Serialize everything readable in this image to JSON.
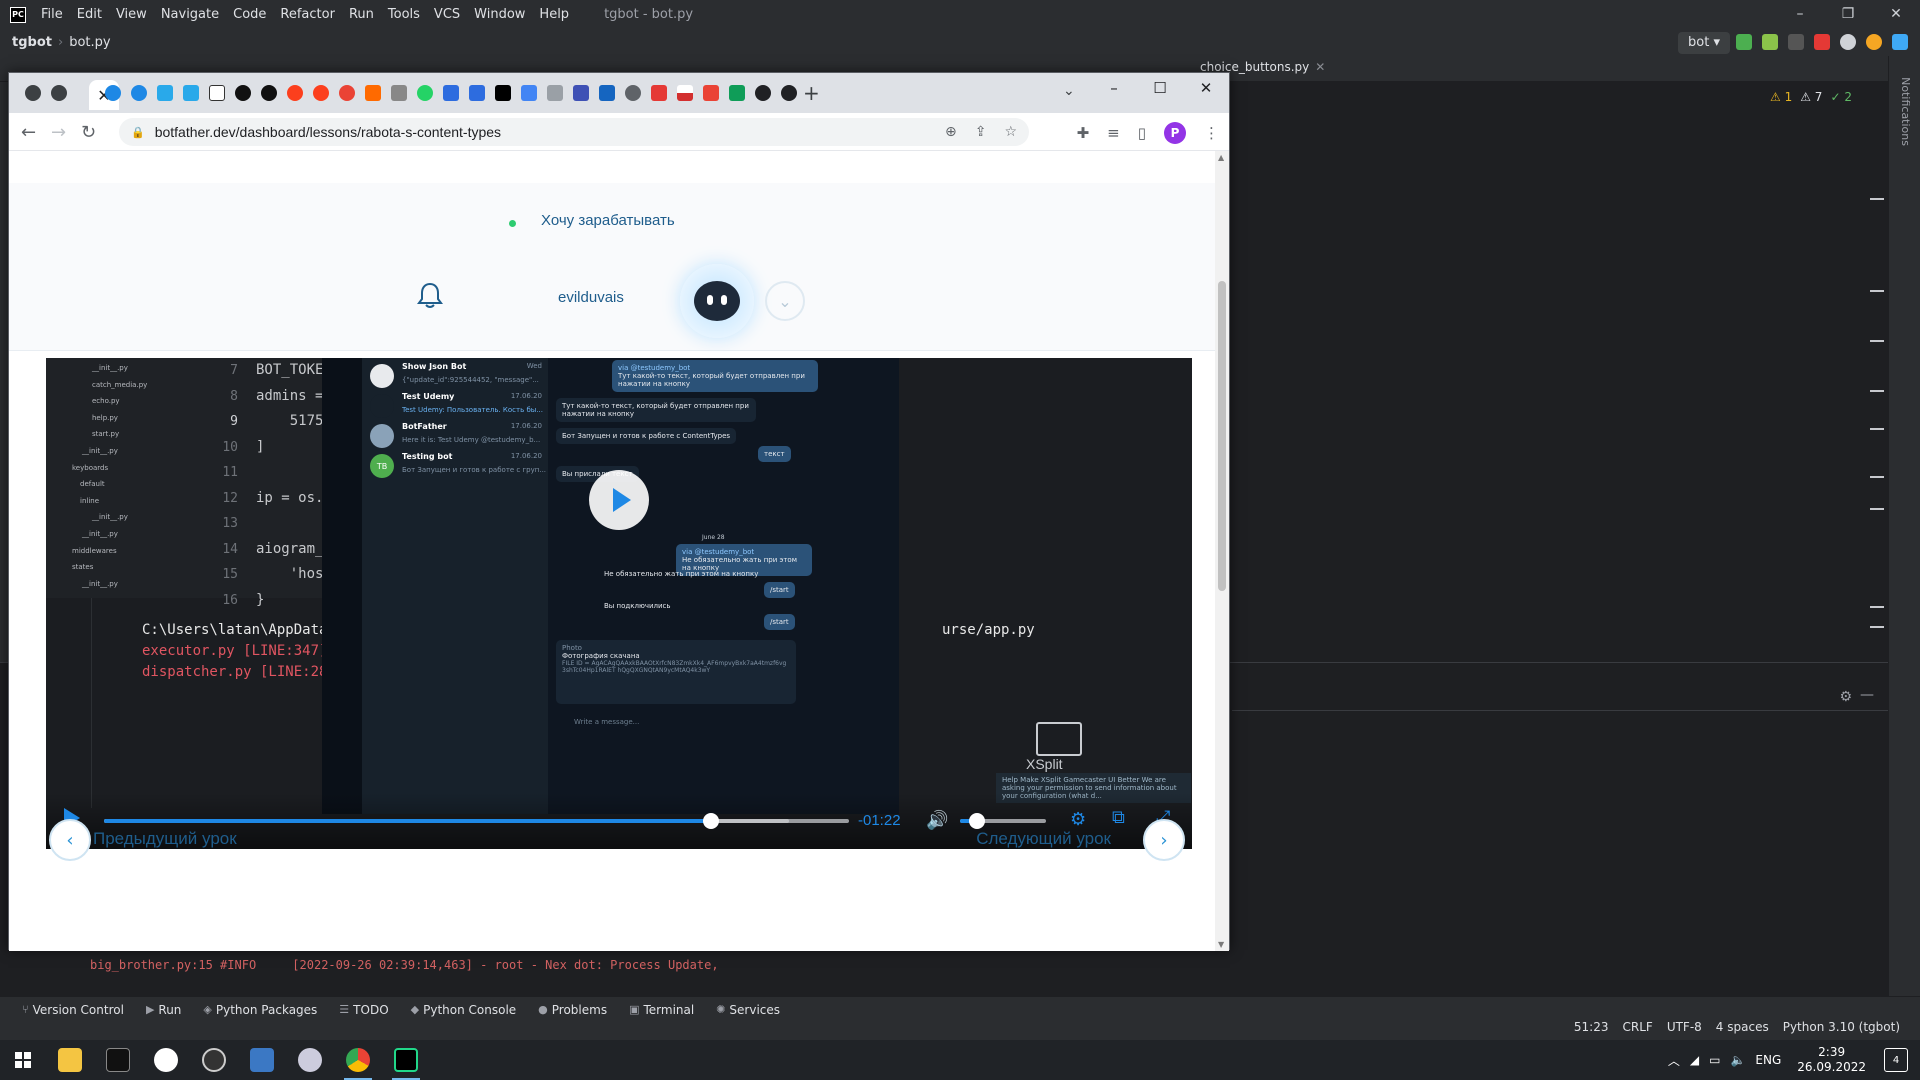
{
  "ide": {
    "menu": [
      "File",
      "Edit",
      "View",
      "Navigate",
      "Code",
      "Refactor",
      "Run",
      "Tools",
      "VCS",
      "Window",
      "Help"
    ],
    "title": "tgbot - bot.py",
    "project": "tgbot",
    "file": "bot.py",
    "run_config": "bot",
    "visible_tab": "choice_buttons.py",
    "warnings": {
      "warn1": "1",
      "warn2": "7",
      "ok": "2"
    },
    "notifications_label": "Notifications",
    "log_line": "big_brother.py:15 #INFO     [2022-09-26 02:39:14,463] - root - Nex dot: Process Update,",
    "toolwindows": [
      "Version Control",
      "Run",
      "Python Packages",
      "TODO",
      "Python Console",
      "Problems",
      "Terminal",
      "Services"
    ],
    "status": {
      "position": "51:23",
      "line_sep": "CRLF",
      "encoding": "UTF-8",
      "indent": "4 spaces",
      "interpreter": "Python 3.10 (tgbot)"
    }
  },
  "browser": {
    "url": "botfather.dev/dashboard/lessons/rabota-s-content-types",
    "profile_initial": "P"
  },
  "site": {
    "earn_link": "Хочу зарабатывать",
    "username": "evilduvais",
    "prev_lesson": "Предыдущий урок",
    "next_lesson": "Следующий урок"
  },
  "video": {
    "time_remaining": "-01:22",
    "progress": 0.815,
    "buffered": 0.92,
    "volume": 0.2,
    "code": {
      "lines": [
        "7",
        "8",
        "9",
        "10",
        "11",
        "12",
        "13",
        "14",
        "15",
        "16"
      ],
      "text": "BOT_TOKEN\nadmins =\n    5175\n]\n\nip = os.\n\naiogram_\n    'host\n}"
    },
    "tree": [
      "__init__.py",
      "catch_media.py",
      "echo.py",
      "help.py",
      "start.py",
      "__init__.py",
      "keyboards",
      "default",
      "inline",
      "__init__.py",
      "__init__.py",
      "middlewares",
      "states",
      "__init__.py"
    ],
    "console": {
      "path": "C:\\Users\\latan\\AppData\\Loc",
      "path_right": "urse/app.py",
      "err1": "executor.py [LINE:347] #IN",
      "err2": "dispatcher.py [LINE:280] #"
    },
    "telegram": {
      "chats": [
        {
          "name": "Show Json Bot",
          "preview": "{\"update_id\":925544452, \"message\"...",
          "date": "Wed"
        },
        {
          "name": "Test Udemy",
          "preview": "Test Udemy: Пользователь. Кость бы...",
          "date": "17.06.20"
        },
        {
          "name": "BotFather",
          "preview": "Here it is: Test Udemy @testudemy_b...",
          "date": "17.06.20"
        },
        {
          "name": "Testing bot",
          "preview": "Бот Запущен и готов к работе с груп...",
          "date": "17.06.20"
        }
      ],
      "testing_initials": "TB",
      "messages": {
        "via": "via @testudemy_bot",
        "out1": "Тут какой-то текст, который будет отправлен при нажатии на кнопку",
        "in1": "Тут какой-то текст, который будет отправлен при нажатии на кнопку",
        "in2": "Бот Запущен и готов к работе с ContentTypes",
        "out2": "текст",
        "in3": "Вы прислали текст",
        "date_sep": "June 28",
        "out3": "Не обязательно жать при этом на кнопку",
        "in4": "Не обязательно жать при этом на кнопку",
        "out4": "/start",
        "in5": "Вы подключились",
        "out5": "/start",
        "photo_title": "Фотография скачана",
        "file_id": "FILE ID = AgACAgQAAxkBAAOtXrfcN83ZmkXk4_AF6mpvyBxk7aA4tmzf6vg3shTc04Hp1RAlET hQgQXGNQtAN9ycMtAQ4k3wY",
        "photo_label": "Photo",
        "compose": "Write a message..."
      }
    },
    "xsplit": "XSplit",
    "help_popup": "Help Make XSplit Gamecaster UI Better We are asking your permission to send information about your configuration (what d..."
  },
  "taskbar": {
    "lang": "ENG",
    "time": "2:39",
    "date": "26.09.2022",
    "notif_count": "4"
  }
}
